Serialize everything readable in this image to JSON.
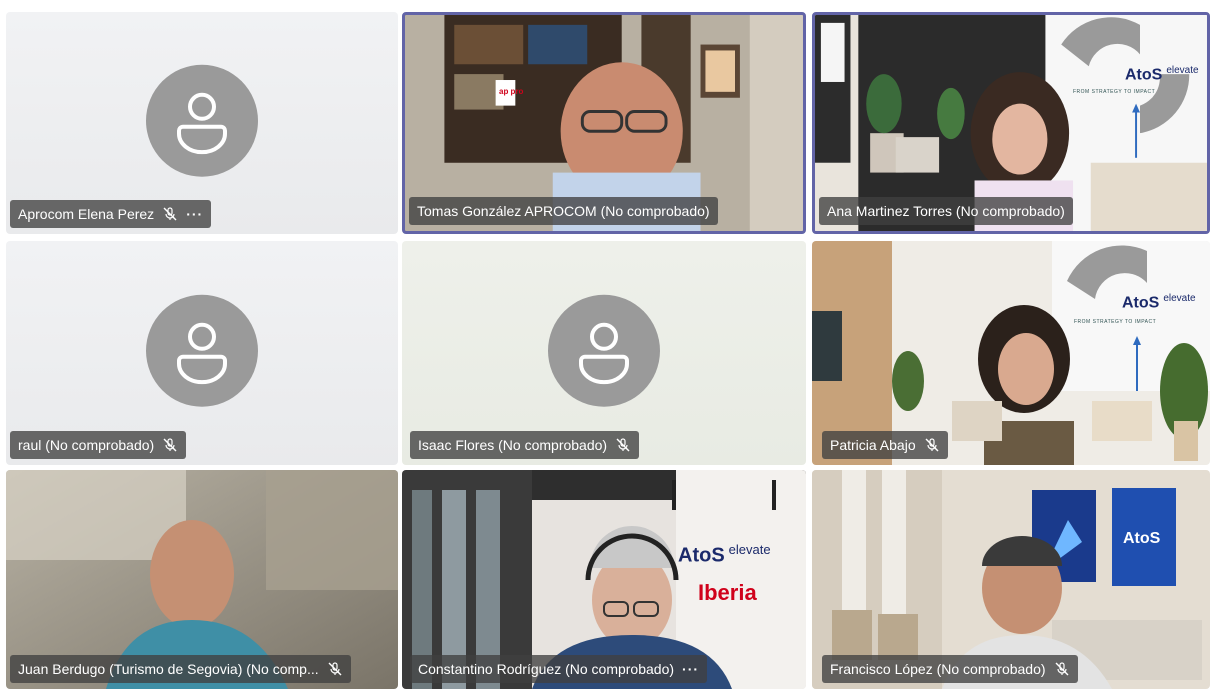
{
  "participants": [
    {
      "name": "Aprocom Elena Perez",
      "mic_muted": true,
      "more_menu": true,
      "speaking": false,
      "video": false
    },
    {
      "name": "Tomas González APROCOM (No comprobado)",
      "mic_muted": false,
      "more_menu": false,
      "speaking": true,
      "video": true
    },
    {
      "name": "Ana Martinez Torres (No comprobado)",
      "mic_muted": false,
      "more_menu": false,
      "speaking": false,
      "video": true
    },
    {
      "name": "raul (No comprobado)",
      "mic_muted": true,
      "more_menu": false,
      "speaking": false,
      "video": false
    },
    {
      "name": "Isaac Flores (No comprobado)",
      "mic_muted": true,
      "more_menu": false,
      "speaking": false,
      "video": false
    },
    {
      "name": "Patricia Abajo",
      "mic_muted": true,
      "more_menu": false,
      "speaking": false,
      "video": true
    },
    {
      "name": "Juan Berdugo (Turismo de Segovia) (No comp...",
      "mic_muted": true,
      "more_menu": false,
      "speaking": false,
      "video": true
    },
    {
      "name": "Constantino Rodríguez (No comprobado)",
      "mic_muted": false,
      "more_menu": true,
      "speaking": false,
      "video": true
    },
    {
      "name": "Francisco López (No comprobado)",
      "mic_muted": true,
      "more_menu": false,
      "speaking": false,
      "video": true
    }
  ],
  "branding": {
    "atos": "AtoS",
    "elevate": "elevate",
    "tagline": "FROM STRATEGY TO IMPACT",
    "iberia": "Iberia",
    "book_badge": "ap pro"
  },
  "more_glyph": "···",
  "colors": {
    "active_border": "#6264a7",
    "nameplate_bg": "#404040",
    "avatar_gray": "#9a9a9a",
    "atos_blue": "#1b2a6b",
    "iberia_red": "#d0021b"
  },
  "icons": {
    "avatar": "person-placeholder-icon",
    "mic": "mic-off-icon",
    "more": "more-options-icon"
  }
}
